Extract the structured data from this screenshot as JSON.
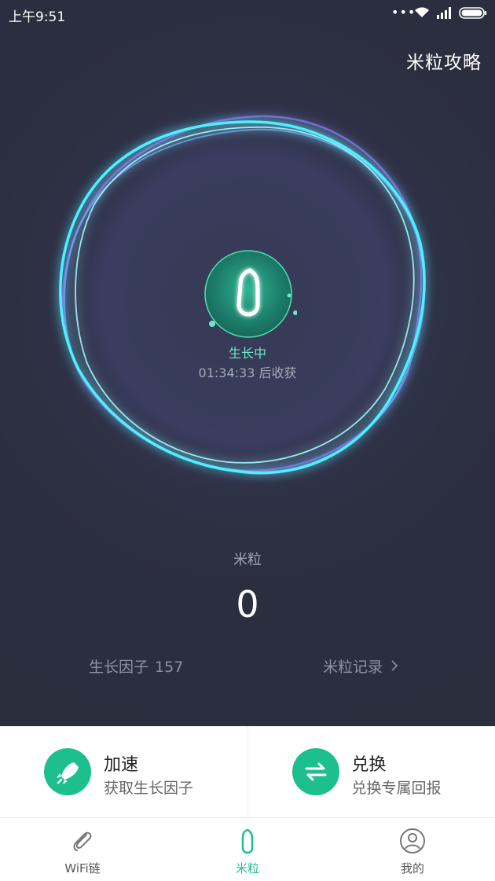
{
  "status_bar": {
    "time": "上午9:51",
    "dots": "•••",
    "icons": [
      "wifi-icon",
      "signal-icon",
      "battery-icon"
    ]
  },
  "header": {
    "strategy_link": "米粒攻略"
  },
  "seed": {
    "status": "生长中",
    "countdown": "01:34:33 后收获",
    "accent": "#6ee7c6"
  },
  "mili": {
    "label": "米粒",
    "value": "0"
  },
  "stats": {
    "factor_label": "生长因子",
    "factor_value": "157",
    "records_label": "米粒记录"
  },
  "actions": [
    {
      "title": "加速",
      "subtitle": "获取生长因子",
      "icon": "rocket-icon"
    },
    {
      "title": "兑换",
      "subtitle": "兑换专属回报",
      "icon": "exchange-icon"
    }
  ],
  "nav": {
    "items": [
      {
        "label": "WiFi链",
        "icon": "paperclip-icon",
        "active": false
      },
      {
        "label": "米粒",
        "icon": "seed-icon",
        "active": true
      },
      {
        "label": "我的",
        "icon": "profile-icon",
        "active": false
      }
    ]
  },
  "colors": {
    "accent": "#1ebf8e",
    "background": "#2c2f3d",
    "ring_cyan": "#4ef0ff",
    "ring_violet": "#8a7cff"
  }
}
